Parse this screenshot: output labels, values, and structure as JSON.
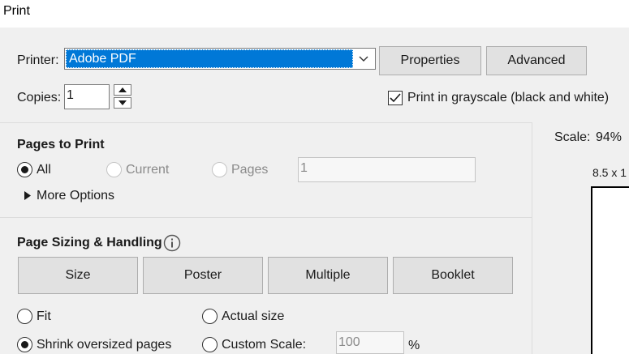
{
  "window": {
    "title": "Print"
  },
  "printer": {
    "label": "Printer:",
    "selected": "Adobe PDF",
    "properties_label": "Properties",
    "advanced_label": "Advanced"
  },
  "copies": {
    "label": "Copies:",
    "value": "1"
  },
  "grayscale": {
    "label": "Print in grayscale (black and white)",
    "checked": true
  },
  "pages_to_print": {
    "heading": "Pages to Print",
    "all_label": "All",
    "current_label": "Current",
    "pages_label": "Pages",
    "pages_value": "1",
    "more_options_label": "More Options"
  },
  "page_sizing": {
    "heading": "Page Sizing & Handling",
    "tabs": [
      {
        "label": "Size",
        "selected": true
      },
      {
        "label": "Poster",
        "selected": false
      },
      {
        "label": "Multiple",
        "selected": false
      },
      {
        "label": "Booklet",
        "selected": false
      }
    ],
    "fit_label": "Fit",
    "actual_size_label": "Actual size",
    "shrink_label": "Shrink oversized pages",
    "custom_scale_label": "Custom Scale:",
    "custom_scale_value": "100",
    "percent_label": "%"
  },
  "preview": {
    "scale_label": "Scale:",
    "scale_value": "94%",
    "paper_size": "8.5 x 1"
  }
}
